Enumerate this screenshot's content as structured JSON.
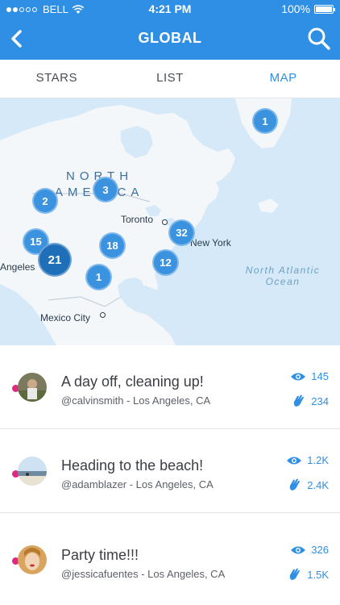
{
  "status": {
    "carrier": "BELL",
    "time": "4:21 PM",
    "battery": "100%"
  },
  "nav": {
    "title": "GLOBAL",
    "back_icon": "chevron-left-icon",
    "search_icon": "search-icon"
  },
  "tabs": [
    {
      "label": "STARS"
    },
    {
      "label": "LIST"
    },
    {
      "label": "MAP",
      "active": true
    }
  ],
  "map": {
    "continent_line1": "NORTH",
    "continent_line2": "AMERICA",
    "toronto": "Toronto",
    "new_york": "New York",
    "angeles": "Angeles",
    "mexico_city": "Mexico City",
    "ocean_line1": "North Atlantic",
    "ocean_line2": "Ocean",
    "clusters": [
      "1",
      "2",
      "3",
      "32",
      "15",
      "18",
      "21",
      "12",
      "1"
    ]
  },
  "feed": [
    {
      "title": "A day off, cleaning up!",
      "subtitle": "@calvinsmith - Los Angeles, CA",
      "views": "145",
      "likes": "234"
    },
    {
      "title": "Heading to the beach!",
      "subtitle": "@adamblazer - Los Angeles, CA",
      "views": "1.2K",
      "likes": "2.4K"
    },
    {
      "title": "Party time!!!",
      "subtitle": "@jessicafuentes - Los Angeles, CA",
      "views": "326",
      "likes": "1.5K"
    }
  ],
  "colors": {
    "accent": "#2f8fe5",
    "dot": "#e0287f"
  }
}
